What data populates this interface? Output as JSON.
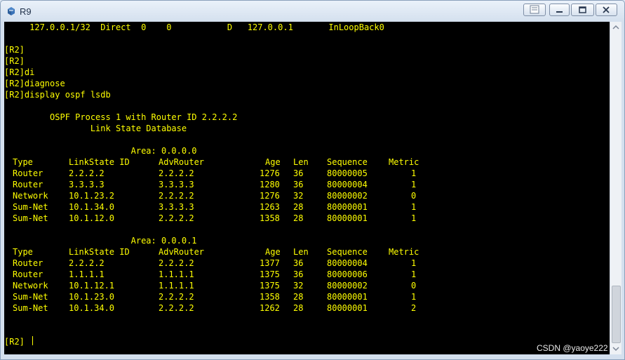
{
  "window": {
    "title": "R9"
  },
  "console": {
    "lines": [
      "     127.0.0.1/32  Direct  0    0           D   127.0.0.1       InLoopBack0",
      "",
      "[R2]",
      "[R2]",
      "[R2]di",
      "[R2]diagnose",
      "[R2]display ospf lsdb",
      "",
      "\t OSPF Process 1 with Router ID 2.2.2.2",
      "\t\t Link State Database",
      "",
      "\t\t         Area: 0.0.0.0"
    ],
    "area1_label": "\t\t         Area: 0.0.0.1",
    "prompt": "[R2]"
  },
  "lsdb": {
    "headers": [
      "Type",
      "LinkState ID",
      "AdvRouter",
      "Age",
      "Len",
      "Sequence",
      "Metric"
    ],
    "area0_rows": [
      [
        "Router",
        "2.2.2.2",
        "2.2.2.2",
        "1276",
        "36",
        "80000005",
        "1"
      ],
      [
        "Router",
        "3.3.3.3",
        "3.3.3.3",
        "1280",
        "36",
        "80000004",
        "1"
      ],
      [
        "Network",
        "10.1.23.2",
        "2.2.2.2",
        "1276",
        "32",
        "80000002",
        "0"
      ],
      [
        "Sum-Net",
        "10.1.34.0",
        "3.3.3.3",
        "1263",
        "28",
        "80000001",
        "1"
      ],
      [
        "Sum-Net",
        "10.1.12.0",
        "2.2.2.2",
        "1358",
        "28",
        "80000001",
        "1"
      ]
    ],
    "area1_rows": [
      [
        "Router",
        "2.2.2.2",
        "2.2.2.2",
        "1377",
        "36",
        "80000004",
        "1"
      ],
      [
        "Router",
        "1.1.1.1",
        "1.1.1.1",
        "1375",
        "36",
        "80000006",
        "1"
      ],
      [
        "Network",
        "10.1.12.1",
        "1.1.1.1",
        "1375",
        "32",
        "80000002",
        "0"
      ],
      [
        "Sum-Net",
        "10.1.23.0",
        "2.2.2.2",
        "1358",
        "28",
        "80000001",
        "1"
      ],
      [
        "Sum-Net",
        "10.1.34.0",
        "2.2.2.2",
        "1262",
        "28",
        "80000001",
        "2"
      ]
    ]
  },
  "watermark": "CSDN @yaoye222",
  "colors": {
    "terminal_bg": "#000000",
    "terminal_text": "#ffff00",
    "window_chrome": "#d4e0ee"
  },
  "icons": {
    "app": "router-app-icon",
    "extra": "window-extra-icon",
    "minimize": "minimize-icon",
    "maximize": "maximize-icon",
    "close": "close-icon"
  }
}
